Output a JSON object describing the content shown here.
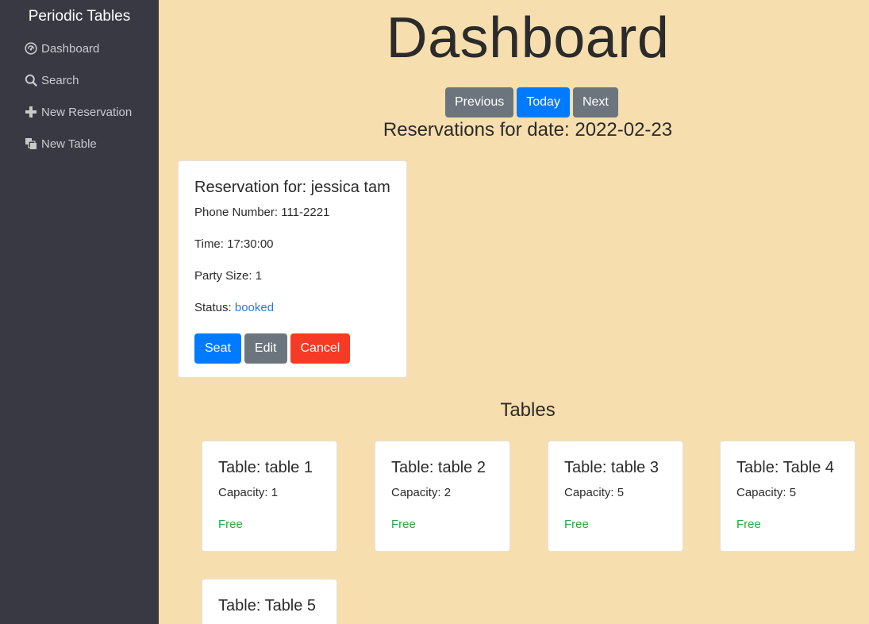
{
  "sidebar": {
    "brand": "Periodic Tables",
    "items": [
      {
        "label": "Dashboard",
        "icon": "dashboard-icon"
      },
      {
        "label": "Search",
        "icon": "search-icon"
      },
      {
        "label": "New Reservation",
        "icon": "plus-icon"
      },
      {
        "label": "New Table",
        "icon": "layers-icon"
      }
    ]
  },
  "main": {
    "title": "Dashboard",
    "date_nav": {
      "previous": "Previous",
      "today": "Today",
      "next": "Next"
    },
    "reservations_heading": "Reservations for date: 2022-02-23",
    "reservations": [
      {
        "title": "Reservation for: jessica tam",
        "phone": "Phone Number: 111-2221",
        "time": "Time: 17:30:00",
        "party": "Party Size: 1",
        "status_label": "Status: ",
        "status": "booked",
        "actions": {
          "seat": "Seat",
          "edit": "Edit",
          "cancel": "Cancel"
        }
      }
    ],
    "tables_heading": "Tables",
    "tables": [
      {
        "title": "Table: table 1",
        "capacity": "Capacity: 1",
        "status": "Free"
      },
      {
        "title": "Table: table 2",
        "capacity": "Capacity: 2",
        "status": "Free"
      },
      {
        "title": "Table: table 3",
        "capacity": "Capacity: 5",
        "status": "Free"
      },
      {
        "title": "Table: Table 4",
        "capacity": "Capacity: 5",
        "status": "Free"
      },
      {
        "title": "Table: Table 5",
        "capacity": "",
        "status": ""
      }
    ]
  },
  "colors": {
    "background": "#f6deae",
    "sidebar": "#393943",
    "primary": "#007bff",
    "secondary": "#6c757d",
    "danger": "#f73a25",
    "free": "#28a745",
    "booked": "#2e7ad1"
  }
}
